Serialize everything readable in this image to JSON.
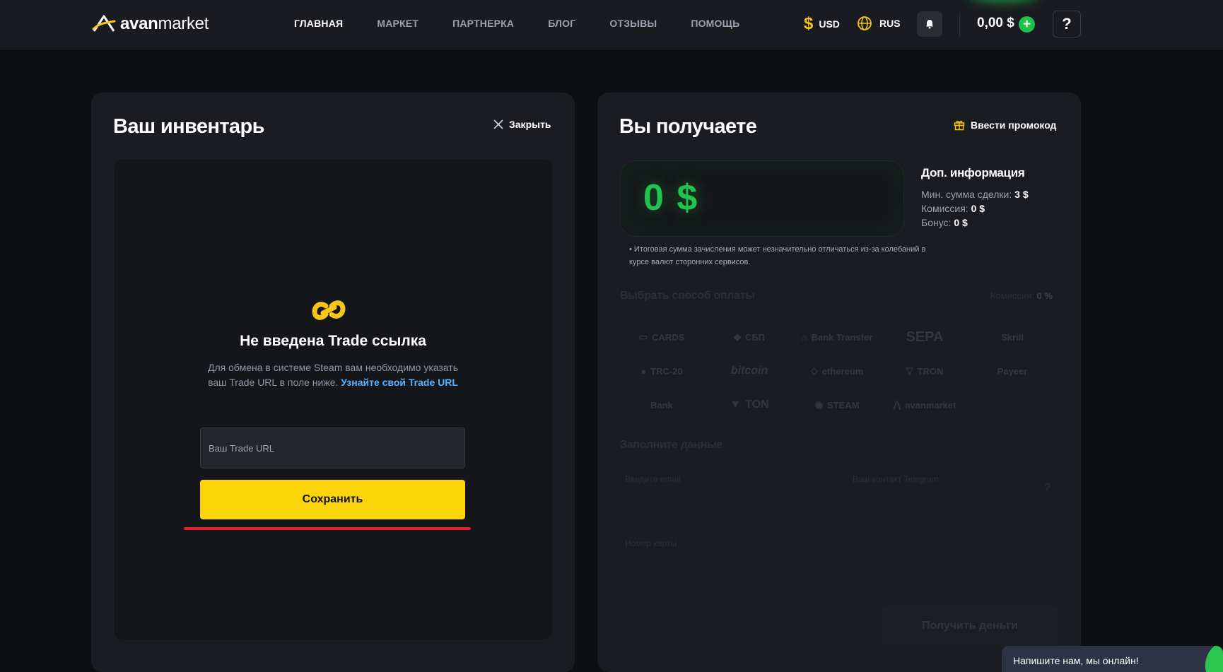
{
  "header": {
    "logo": {
      "prefix": "avan",
      "suffix": "market"
    },
    "nav": [
      "ГЛАВНАЯ",
      "МАРКЕТ",
      "ПАРТНЕРКА",
      "БЛОГ",
      "ОТЗЫВЫ",
      "ПОМОЩЬ"
    ],
    "currency": "USD",
    "currency_symbol": "$",
    "language": "RUS",
    "balance": "0,00 $",
    "add_funds_symbol": "+",
    "help_symbol": "?"
  },
  "inventory": {
    "title": "Ваш инвентарь",
    "close_label": "Закрыть",
    "empty_heading": "Не введена Trade ссылка",
    "desc": "Для обмена в системе Steam вам необходимо указать ваш Trade URL в поле ниже.",
    "desc_link": "Узнайте свой Trade URL",
    "input_placeholder": "Ваш Trade URL",
    "save_label": "Сохранить"
  },
  "receive": {
    "title": "Вы получаете",
    "promo_label": "Ввести промокод",
    "amount": "0 $",
    "info_title": "Доп. информация",
    "info": [
      {
        "label": "Мин. сумма сделки:",
        "value": "3 $"
      },
      {
        "label": "Комиссия:",
        "value": "0 $"
      },
      {
        "label": "Бонус:",
        "value": "0 $"
      }
    ],
    "disclaimer": "• Итоговая сумма зачисления может незначительно отличаться из-за колебаний в курсе валют сторонних сервисов.",
    "payment_title": "Выбрать способ оплаты",
    "payment_commission_label": "Комиссия:",
    "payment_commission_value": "0 %",
    "payment_methods": [
      "CARDS",
      "СБП",
      "Bank Transfer",
      "SEPA",
      "Skrill",
      "TRC-20",
      "bitcoin",
      "ethereum",
      "TRON",
      "Payeer",
      "Bank",
      "TON",
      "STEAM",
      "avanmarket"
    ],
    "fill_title": "Заполните данные",
    "email_placeholder": "Введите email",
    "telegram_placeholder": "Ваш контакт Telegram",
    "telegram_help": "?",
    "card_placeholder": "Номер карты",
    "submit_label": "Получить деньги"
  },
  "chat": {
    "label": "Напишите нам, мы онлайн!"
  },
  "colors": {
    "accent_yellow": "#fcd40a",
    "accent_green": "#23c24d",
    "link_blue": "#58b3ff",
    "warning_red": "#dc1f2a"
  }
}
